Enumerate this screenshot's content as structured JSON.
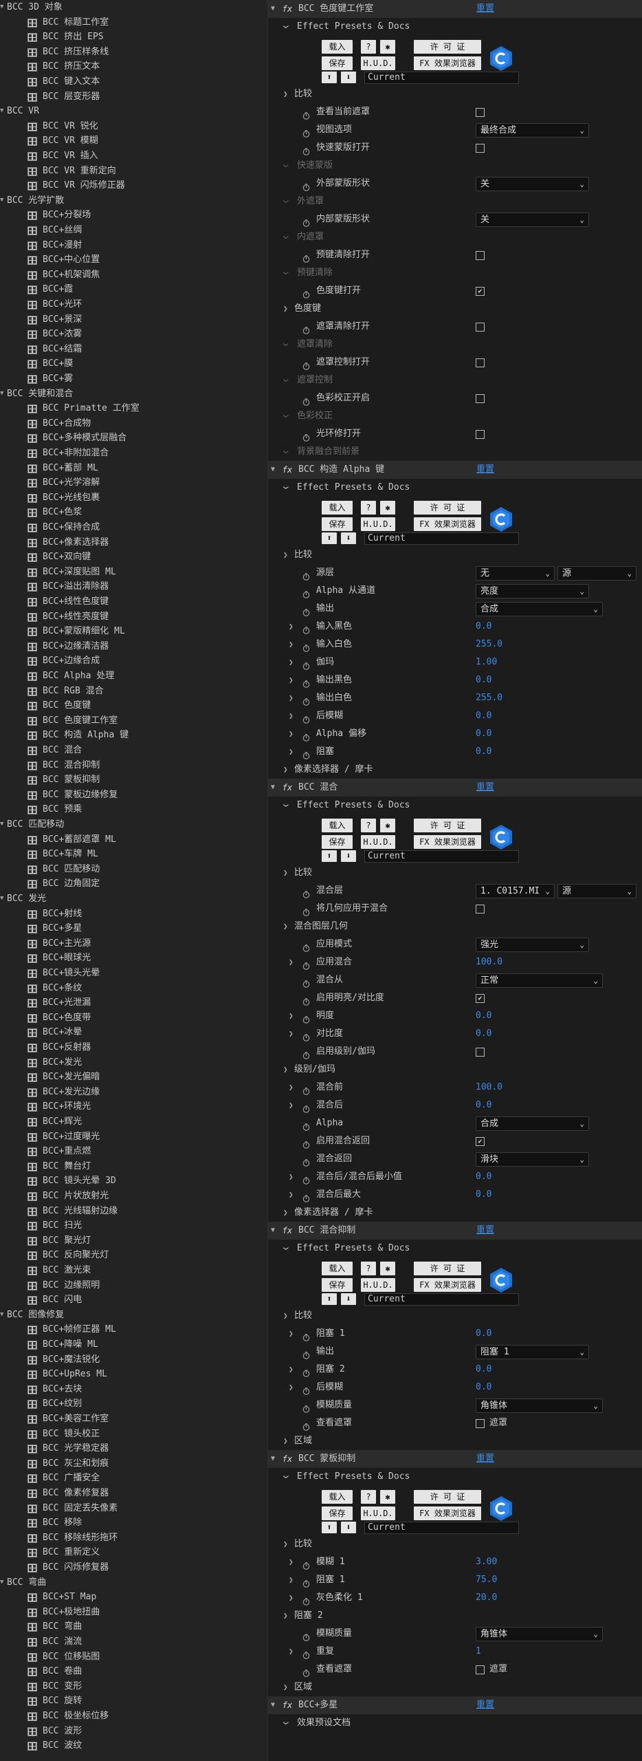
{
  "left_panel": {
    "items": [
      {
        "lvl": 0,
        "label": "BCC 3D 对象"
      },
      {
        "lvl": 1,
        "label": "BCC 标题工作室"
      },
      {
        "lvl": 1,
        "label": "BCC 挤出 EPS"
      },
      {
        "lvl": 1,
        "label": "BCC 挤压样条线"
      },
      {
        "lvl": 1,
        "label": "BCC 挤压文本"
      },
      {
        "lvl": 1,
        "label": "BCC 键入文本"
      },
      {
        "lvl": 1,
        "label": "BCC 层变形器"
      },
      {
        "lvl": 0,
        "label": "BCC VR"
      },
      {
        "lvl": 1,
        "label": "BCC VR 锐化"
      },
      {
        "lvl": 1,
        "label": "BCC VR 模糊"
      },
      {
        "lvl": 1,
        "label": "BCC VR 插入"
      },
      {
        "lvl": 1,
        "label": "BCC VR 重新定向"
      },
      {
        "lvl": 1,
        "label": "BCC VR 闪烁修正器"
      },
      {
        "lvl": 0,
        "label": "BCC 光学扩散"
      },
      {
        "lvl": 1,
        "label": "BCC+分裂场"
      },
      {
        "lvl": 1,
        "label": "BCC+丝绸"
      },
      {
        "lvl": 1,
        "label": "BCC+漫射"
      },
      {
        "lvl": 1,
        "label": "BCC+中心位置"
      },
      {
        "lvl": 1,
        "label": "BCC+机架调焦"
      },
      {
        "lvl": 1,
        "label": "BCC+霞"
      },
      {
        "lvl": 1,
        "label": "BCC+光环"
      },
      {
        "lvl": 1,
        "label": "BCC+景深"
      },
      {
        "lvl": 1,
        "label": "BCC+浓雾"
      },
      {
        "lvl": 1,
        "label": "BCC+结霜"
      },
      {
        "lvl": 1,
        "label": "BCC+膜"
      },
      {
        "lvl": 1,
        "label": "BCC+雾"
      },
      {
        "lvl": 0,
        "label": "BCC 关键和混合"
      },
      {
        "lvl": 1,
        "label": "BCC Primatte 工作室"
      },
      {
        "lvl": 1,
        "label": "BCC+合成物"
      },
      {
        "lvl": 1,
        "label": "BCC+多种模式层融合"
      },
      {
        "lvl": 1,
        "label": "BCC+非附加混合"
      },
      {
        "lvl": 1,
        "label": "BCC+蓄部 ML"
      },
      {
        "lvl": 1,
        "label": "BCC+光学溶解"
      },
      {
        "lvl": 1,
        "label": "BCC+光线包裹"
      },
      {
        "lvl": 1,
        "label": "BCC+色浆"
      },
      {
        "lvl": 1,
        "label": "BCC+保持合成"
      },
      {
        "lvl": 1,
        "label": "BCC+像素选择器"
      },
      {
        "lvl": 1,
        "label": "BCC+双向键"
      },
      {
        "lvl": 1,
        "label": "BCC+深度贴图 ML"
      },
      {
        "lvl": 1,
        "label": "BCC+溢出清除器"
      },
      {
        "lvl": 1,
        "label": "BCC+线性色度键"
      },
      {
        "lvl": 1,
        "label": "BCC+线性亮度键"
      },
      {
        "lvl": 1,
        "label": "BCC+蒙版精细化 ML"
      },
      {
        "lvl": 1,
        "label": "BCC+边缘清洁器"
      },
      {
        "lvl": 1,
        "label": "BCC+边缘合成"
      },
      {
        "lvl": 1,
        "label": "BCC Alpha 处理"
      },
      {
        "lvl": 1,
        "label": "BCC RGB 混合"
      },
      {
        "lvl": 1,
        "label": "BCC 色度键"
      },
      {
        "lvl": 1,
        "label": "BCC 色度键工作室"
      },
      {
        "lvl": 1,
        "label": "BCC 构造 Alpha 键"
      },
      {
        "lvl": 1,
        "label": "BCC 混合"
      },
      {
        "lvl": 1,
        "label": "BCC 混合抑制"
      },
      {
        "lvl": 1,
        "label": "BCC 蒙板抑制"
      },
      {
        "lvl": 1,
        "label": "BCC 蒙板边缘修复"
      },
      {
        "lvl": 1,
        "label": "BCC 预乘"
      },
      {
        "lvl": 0,
        "label": "BCC 匹配移动"
      },
      {
        "lvl": 1,
        "label": "BCC+蓄部遮罩 ML"
      },
      {
        "lvl": 1,
        "label": "BCC+车牌 ML"
      },
      {
        "lvl": 1,
        "label": "BCC 匹配移动"
      },
      {
        "lvl": 1,
        "label": "BCC 边角固定"
      },
      {
        "lvl": 0,
        "label": "BCC 发光"
      },
      {
        "lvl": 1,
        "label": "BCC+射线"
      },
      {
        "lvl": 1,
        "label": "BCC+多星"
      },
      {
        "lvl": 1,
        "label": "BCC+主光源"
      },
      {
        "lvl": 1,
        "label": "BCC+眼球光"
      },
      {
        "lvl": 1,
        "label": "BCC+镜头光晕"
      },
      {
        "lvl": 1,
        "label": "BCC+条纹"
      },
      {
        "lvl": 1,
        "label": "BCC+光泄漏"
      },
      {
        "lvl": 1,
        "label": "BCC+色度带"
      },
      {
        "lvl": 1,
        "label": "BCC+冰晕"
      },
      {
        "lvl": 1,
        "label": "BCC+反射器"
      },
      {
        "lvl": 1,
        "label": "BCC+发光"
      },
      {
        "lvl": 1,
        "label": "BCC+发光偏暗"
      },
      {
        "lvl": 1,
        "label": "BCC+发光边缘"
      },
      {
        "lvl": 1,
        "label": "BCC+环境光"
      },
      {
        "lvl": 1,
        "label": "BCC+辉光"
      },
      {
        "lvl": 1,
        "label": "BCC+过度曝光"
      },
      {
        "lvl": 1,
        "label": "BCC+重点燃"
      },
      {
        "lvl": 1,
        "label": "BCC 舞台灯"
      },
      {
        "lvl": 1,
        "label": "BCC 镜头光晕 3D"
      },
      {
        "lvl": 1,
        "label": "BCC 片状放射光"
      },
      {
        "lvl": 1,
        "label": "BCC 光线辐射边缘"
      },
      {
        "lvl": 1,
        "label": "BCC 扫光"
      },
      {
        "lvl": 1,
        "label": "BCC 聚光灯"
      },
      {
        "lvl": 1,
        "label": "BCC 反向聚光灯"
      },
      {
        "lvl": 1,
        "label": "BCC 激光束"
      },
      {
        "lvl": 1,
        "label": "BCC 边缘照明"
      },
      {
        "lvl": 1,
        "label": "BCC 闪电"
      },
      {
        "lvl": 0,
        "label": "BCC 图像修复"
      },
      {
        "lvl": 1,
        "label": "BCC+帧修正器 ML"
      },
      {
        "lvl": 1,
        "label": "BCC+降噪 ML"
      },
      {
        "lvl": 1,
        "label": "BCC+魔法锐化"
      },
      {
        "lvl": 1,
        "label": "BCC+UpRes ML"
      },
      {
        "lvl": 1,
        "label": "BCC+去块"
      },
      {
        "lvl": 1,
        "label": "BCC+纹别"
      },
      {
        "lvl": 1,
        "label": "BCC+美容工作室"
      },
      {
        "lvl": 1,
        "label": "BCC 镜头校正"
      },
      {
        "lvl": 1,
        "label": "BCC 光学稳定器"
      },
      {
        "lvl": 1,
        "label": "BCC 灰尘和划痕"
      },
      {
        "lvl": 1,
        "label": "BCC 广播安全"
      },
      {
        "lvl": 1,
        "label": "BCC 像素修复器"
      },
      {
        "lvl": 1,
        "label": "BCC 固定丢失像素"
      },
      {
        "lvl": 1,
        "label": "BCC 移除"
      },
      {
        "lvl": 1,
        "label": "BCC 移除线形拖环"
      },
      {
        "lvl": 1,
        "label": "BCC 重新定义"
      },
      {
        "lvl": 1,
        "label": "BCC 闪烁修复器"
      },
      {
        "lvl": 0,
        "label": "BCC 弯曲"
      },
      {
        "lvl": 1,
        "label": "BCC+ST Map"
      },
      {
        "lvl": 1,
        "label": "BCC+极地扭曲"
      },
      {
        "lvl": 1,
        "label": "BCC 弯曲"
      },
      {
        "lvl": 1,
        "label": "BCC 湍流"
      },
      {
        "lvl": 1,
        "label": "BCC 位移贴图"
      },
      {
        "lvl": 1,
        "label": "BCC 卷曲"
      },
      {
        "lvl": 1,
        "label": "BCC 变形"
      },
      {
        "lvl": 1,
        "label": "BCC 旋转"
      },
      {
        "lvl": 1,
        "label": "BCC 极坐标位移"
      },
      {
        "lvl": 1,
        "label": "BCC 波形"
      },
      {
        "lvl": 1,
        "label": "BCC 波纹"
      }
    ]
  },
  "preset_ui": {
    "load": "载入",
    "help": "?",
    "gear": "✱",
    "license": "许 可 证",
    "save": "保存",
    "hud": "H.U.D.",
    "fx_browser": "FX 效果浏览器",
    "current": "Current"
  },
  "effect_rows": [
    {
      "t": "hdr",
      "label": "BCC 色度键工作室",
      "reset": "重置"
    },
    {
      "t": "grp",
      "label": "Effect Presets & Docs",
      "lvl": 1
    },
    {
      "t": "preset"
    },
    {
      "t": "grp",
      "label": "比较",
      "lvl": 1,
      "closed": true
    },
    {
      "t": "chk",
      "label": "查看当前遮罩",
      "checked": false
    },
    {
      "t": "dd",
      "label": "视图选项",
      "value": "最终合成"
    },
    {
      "t": "chk",
      "label": "快速蒙版打开",
      "checked": false
    },
    {
      "t": "grp",
      "label": "快速蒙版",
      "lvl": 1,
      "dim": true
    },
    {
      "t": "dd",
      "label": "外部蒙版形状",
      "value": "关"
    },
    {
      "t": "grp",
      "label": "外遮罩",
      "lvl": 1,
      "dim": true
    },
    {
      "t": "dd",
      "label": "内部蒙版形状",
      "value": "关"
    },
    {
      "t": "grp",
      "label": "内遮罩",
      "lvl": 1,
      "dim": true
    },
    {
      "t": "chk",
      "label": "预键清除打开",
      "checked": false
    },
    {
      "t": "grp",
      "label": "预键清除",
      "lvl": 1,
      "dim": true
    },
    {
      "t": "chk",
      "label": "色度键打开",
      "checked": true
    },
    {
      "t": "grp",
      "label": "色度键",
      "lvl": 1,
      "closed": true
    },
    {
      "t": "chk",
      "label": "遮罩清除打开",
      "checked": false
    },
    {
      "t": "grp",
      "label": "遮罩清除",
      "lvl": 1,
      "dim": true
    },
    {
      "t": "chk",
      "label": "遮罩控制打开",
      "checked": false
    },
    {
      "t": "grp",
      "label": "遮罩控制",
      "lvl": 1,
      "dim": true
    },
    {
      "t": "chk",
      "label": "色彩校正开启",
      "checked": false
    },
    {
      "t": "grp",
      "label": "色彩校正",
      "lvl": 1,
      "dim": true
    },
    {
      "t": "chk",
      "label": "光环修打开",
      "checked": false
    },
    {
      "t": "grp",
      "label": "背景融合到前景",
      "lvl": 1,
      "dim": true
    },
    {
      "t": "hdr",
      "label": "BCC 构造 Alpha 键",
      "reset": "重置"
    },
    {
      "t": "grp",
      "label": "Effect Presets & Docs",
      "lvl": 1
    },
    {
      "t": "preset"
    },
    {
      "t": "grp",
      "label": "比较",
      "lvl": 1,
      "closed": true
    },
    {
      "t": "dd2",
      "label": "源层",
      "value": "无",
      "value2": "源"
    },
    {
      "t": "dd",
      "label": "Alpha 从通道",
      "value": "亮度"
    },
    {
      "t": "dd",
      "label": "输出",
      "value": "合成",
      "wide": true
    },
    {
      "t": "num",
      "label": "输入黑色",
      "value": "0.0",
      "exp": true
    },
    {
      "t": "num",
      "label": "输入白色",
      "value": "255.0",
      "exp": true
    },
    {
      "t": "num",
      "label": "伽玛",
      "value": "1.00",
      "exp": true
    },
    {
      "t": "num",
      "label": "输出黑色",
      "value": "0.0",
      "exp": true
    },
    {
      "t": "num",
      "label": "输出白色",
      "value": "255.0",
      "exp": true
    },
    {
      "t": "num",
      "label": "后模糊",
      "value": "0.0",
      "exp": true
    },
    {
      "t": "num",
      "label": "Alpha 偏移",
      "value": "0.0",
      "exp": true
    },
    {
      "t": "num",
      "label": "阻塞",
      "value": "0.0",
      "exp": true
    },
    {
      "t": "grp",
      "label": "像素选择器 / 摩卡",
      "lvl": 1,
      "closed": true
    },
    {
      "t": "hdr",
      "label": "BCC 混合",
      "reset": "重置"
    },
    {
      "t": "grp",
      "label": "Effect Presets & Docs",
      "lvl": 1
    },
    {
      "t": "preset"
    },
    {
      "t": "grp",
      "label": "比较",
      "lvl": 1,
      "closed": true
    },
    {
      "t": "dd2",
      "label": "混合层",
      "value": "1. C0157.MI",
      "value2": "源"
    },
    {
      "t": "chk",
      "label": "将几何应用于混合",
      "checked": false
    },
    {
      "t": "grp",
      "label": "混合图层几何",
      "lvl": 1,
      "closed": true
    },
    {
      "t": "dd",
      "label": "应用模式",
      "value": "强光"
    },
    {
      "t": "num",
      "label": "应用混合",
      "value": "100.0",
      "exp": true
    },
    {
      "t": "dd",
      "label": "混合从",
      "value": "正常",
      "wide": true
    },
    {
      "t": "chk",
      "label": "启用明亮/对比度",
      "checked": true
    },
    {
      "t": "num",
      "label": "明度",
      "value": "0.0",
      "exp": true
    },
    {
      "t": "num",
      "label": "对比度",
      "value": "0.0",
      "exp": true
    },
    {
      "t": "chk",
      "label": "启用级别/伽玛",
      "checked": false
    },
    {
      "t": "grp",
      "label": "级别/伽玛",
      "lvl": 1,
      "closed": true
    },
    {
      "t": "num",
      "label": "混合前",
      "value": "100.0",
      "exp": true
    },
    {
      "t": "num",
      "label": "混合后",
      "value": "0.0",
      "exp": true
    },
    {
      "t": "dd",
      "label": "Alpha",
      "value": "合成"
    },
    {
      "t": "chk",
      "label": "启用混合返回",
      "checked": true
    },
    {
      "t": "dd",
      "label": "混合返回",
      "value": "滑块"
    },
    {
      "t": "num",
      "label": "混合后/混合后最小值",
      "value": "0.0",
      "exp": true
    },
    {
      "t": "num",
      "label": "混合后最大",
      "value": "0.0",
      "exp": true
    },
    {
      "t": "grp",
      "label": "像素选择器 / 摩卡",
      "lvl": 1,
      "closed": true
    },
    {
      "t": "hdr",
      "label": "BCC 混合抑制",
      "reset": "重置"
    },
    {
      "t": "grp",
      "label": "Effect Presets & Docs",
      "lvl": 1
    },
    {
      "t": "preset"
    },
    {
      "t": "grp",
      "label": "比较",
      "lvl": 1,
      "closed": true
    },
    {
      "t": "num",
      "label": "阻塞 1",
      "value": "0.0",
      "exp": true
    },
    {
      "t": "dd",
      "label": "输出",
      "value": "阻塞 1"
    },
    {
      "t": "num",
      "label": "阻塞 2",
      "value": "0.0",
      "exp": true
    },
    {
      "t": "num",
      "label": "后模糊",
      "value": "0.0",
      "exp": true
    },
    {
      "t": "dd",
      "label": "模糊质量",
      "value": "角锥体",
      "wide": true
    },
    {
      "t": "chk2",
      "label": "查看遮罩",
      "checked": false,
      "side": "遮罩"
    },
    {
      "t": "grp",
      "label": "区域",
      "lvl": 1,
      "closed": true
    },
    {
      "t": "hdr",
      "label": "BCC 蒙板抑制",
      "reset": "重置"
    },
    {
      "t": "grp",
      "label": "Effect Presets & Docs",
      "lvl": 1
    },
    {
      "t": "preset"
    },
    {
      "t": "grp",
      "label": "比较",
      "lvl": 1,
      "closed": true
    },
    {
      "t": "num",
      "label": "模糊 1",
      "value": "3.00",
      "exp": true
    },
    {
      "t": "num",
      "label": "阻塞 1",
      "value": "75.0",
      "exp": true
    },
    {
      "t": "num",
      "label": "灰色柔化 1",
      "value": "20.0",
      "exp": true
    },
    {
      "t": "grp",
      "label": "阻塞 2",
      "lvl": 1,
      "closed": true
    },
    {
      "t": "dd",
      "label": "模糊质量",
      "value": "角锥体",
      "wide": true
    },
    {
      "t": "num",
      "label": "重复",
      "value": "1",
      "exp": true
    },
    {
      "t": "chk2",
      "label": "查看遮罩",
      "checked": false,
      "side": "遮罩"
    },
    {
      "t": "grp",
      "label": "区域",
      "lvl": 1,
      "closed": true
    },
    {
      "t": "hdr",
      "label": "BCC+多星",
      "reset": "重置"
    },
    {
      "t": "grp",
      "label": "效果预设文档",
      "lvl": 1
    }
  ]
}
